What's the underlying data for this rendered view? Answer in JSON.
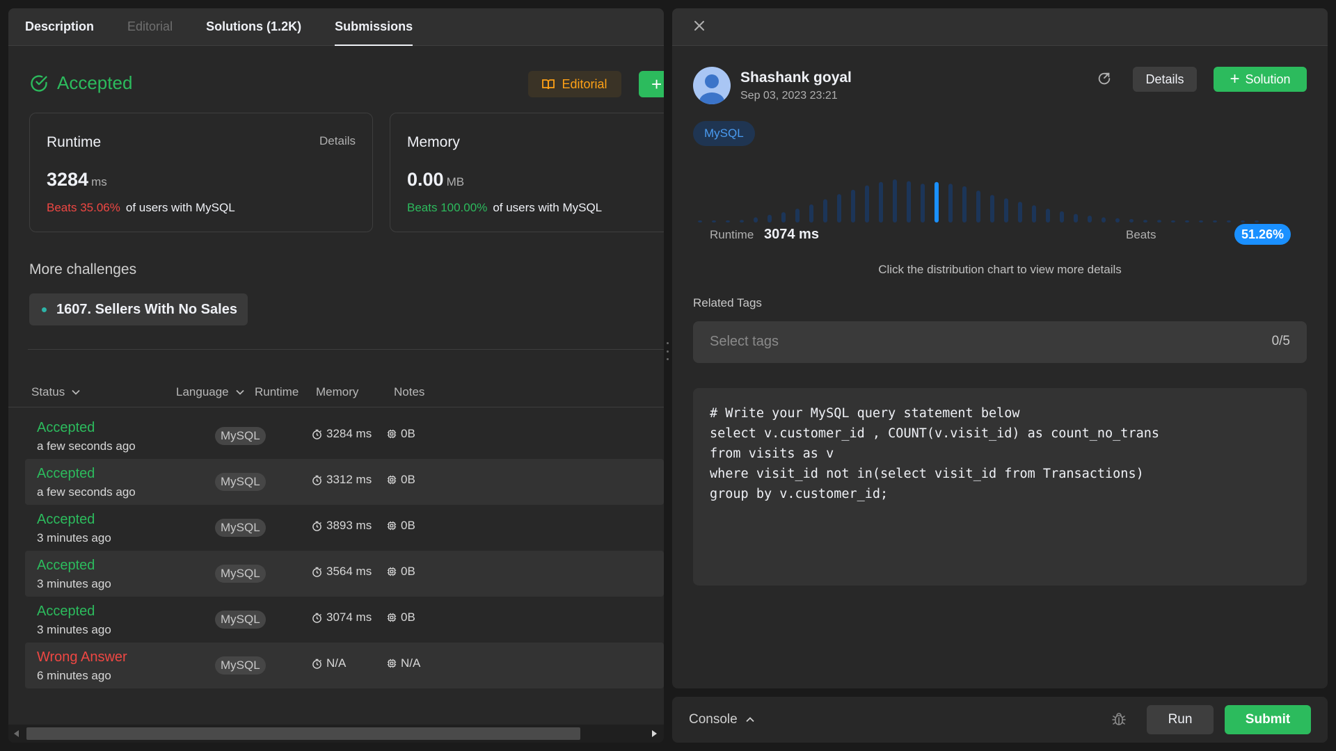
{
  "tabs": [
    {
      "label": "Description"
    },
    {
      "label": "Editorial"
    },
    {
      "label": "Solutions (1.2K)"
    },
    {
      "label": "Submissions"
    }
  ],
  "result": {
    "status": "Accepted",
    "editorial_label": "Editorial",
    "add_label": "+"
  },
  "runtime_card": {
    "title": "Runtime",
    "details": "Details",
    "value": "3284",
    "unit": "ms",
    "beats": "Beats 35.06%",
    "beats_rest": "of users with MySQL"
  },
  "memory_card": {
    "title": "Memory",
    "value": "0.00",
    "unit": "MB",
    "beats": "Beats 100.00%",
    "beats_rest": "of users with MySQL"
  },
  "more_challenges": {
    "title": "More challenges",
    "items": [
      {
        "label": "1607. Sellers With No Sales"
      }
    ]
  },
  "table": {
    "headers": {
      "status": "Status",
      "language": "Language",
      "runtime": "Runtime",
      "memory": "Memory",
      "notes": "Notes"
    },
    "rows": [
      {
        "status": "Accepted",
        "time": "a few seconds ago",
        "lang": "MySQL",
        "runtime": "3284 ms",
        "memory": "0B"
      },
      {
        "status": "Accepted",
        "time": "a few seconds ago",
        "lang": "MySQL",
        "runtime": "3312 ms",
        "memory": "0B"
      },
      {
        "status": "Accepted",
        "time": "3 minutes ago",
        "lang": "MySQL",
        "runtime": "3893 ms",
        "memory": "0B"
      },
      {
        "status": "Accepted",
        "time": "3 minutes ago",
        "lang": "MySQL",
        "runtime": "3564 ms",
        "memory": "0B"
      },
      {
        "status": "Accepted",
        "time": "3 minutes ago",
        "lang": "MySQL",
        "runtime": "3074 ms",
        "memory": "0B"
      },
      {
        "status": "Wrong Answer",
        "time": "6 minutes ago",
        "lang": "MySQL",
        "runtime": "N/A",
        "memory": "N/A"
      }
    ]
  },
  "detail": {
    "user_name": "Shashank goyal",
    "date": "Sep 03, 2023 23:21",
    "details_label": "Details",
    "solution_label": "Solution",
    "language": "MySQL",
    "runtime_label": "Runtime",
    "runtime_value": "3074 ms",
    "beats_label": "Beats",
    "beats_value": "51.26%",
    "hint": "Click the distribution chart to view more details",
    "related_tags_label": "Related Tags",
    "tags_placeholder": "Select tags",
    "tags_count": "0/5",
    "code": [
      "# Write your MySQL query statement below",
      "select v.customer_id , COUNT(v.visit_id) as count_no_trans",
      "from visits as v",
      "where visit_id not in(select visit_id from Transactions)",
      "group by v.customer_id;"
    ]
  },
  "distribution": {
    "bar_levels": [
      0.05,
      0.05,
      0.05,
      0.06,
      0.12,
      0.18,
      0.24,
      0.32,
      0.42,
      0.54,
      0.66,
      0.76,
      0.86,
      0.94,
      1.0,
      0.96,
      0.9,
      0.94,
      0.9,
      0.84,
      0.74,
      0.64,
      0.56,
      0.48,
      0.4,
      0.32,
      0.26,
      0.2,
      0.16,
      0.12,
      0.1,
      0.08,
      0.06,
      0.06,
      0.05,
      0.05,
      0.05,
      0.05,
      0.05,
      0.05,
      0.05
    ],
    "highlight_index": 17,
    "highlight_color": "#1a90ff",
    "bar_color": "#1c3558"
  },
  "console": {
    "label": "Console",
    "run_label": "Run",
    "submit_label": "Submit"
  },
  "colors": {
    "accent_green": "#2cbb5d",
    "error_red": "#ef4743",
    "editorial_orange": "#ffa116",
    "beats_blue": "#1a90ff"
  }
}
